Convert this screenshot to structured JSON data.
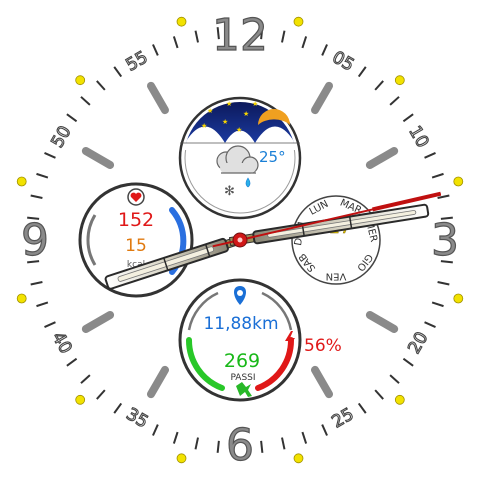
{
  "dial": {
    "hour_numerals": [
      {
        "label": "12",
        "angle": 0
      },
      {
        "label": "3",
        "angle": 90
      },
      {
        "label": "6",
        "angle": 180
      },
      {
        "label": "9",
        "angle": 270
      }
    ],
    "minute_numerals": [
      {
        "label": "05",
        "angle": 30
      },
      {
        "label": "10",
        "angle": 60
      },
      {
        "label": "20",
        "angle": 120
      },
      {
        "label": "25",
        "angle": 150
      },
      {
        "label": "35",
        "angle": 210
      },
      {
        "label": "40",
        "angle": 240
      },
      {
        "label": "50",
        "angle": 300
      },
      {
        "label": "55",
        "angle": 330
      }
    ],
    "colors": {
      "marker_gray": "#8a8a8a",
      "dot_yellow": "#f2e200",
      "tick_dark": "#333333"
    }
  },
  "weather": {
    "temperature": "25°",
    "colors": {
      "sky": "#10206e",
      "temp": "#1a7fd6"
    }
  },
  "heart": {
    "rate": "152",
    "secondary_value": "15",
    "unit": "kcal",
    "colors": {
      "rate": "#e01818",
      "secondary": "#e07a10",
      "arc": "#2a6fe0"
    }
  },
  "activity": {
    "distance": "11,88km",
    "steps": "269",
    "steps_label": "PASSI",
    "battery": "56%",
    "colors": {
      "distance": "#1a6fd6",
      "steps": "#18b818",
      "battery": "#e01818"
    }
  },
  "calendar": {
    "day_names": [
      "DOM",
      "LUN",
      "MAR",
      "MER",
      "GIO",
      "VEN",
      "SAB"
    ],
    "date": "27",
    "colors": {
      "date": "#e0c800"
    }
  },
  "hands": {
    "hour_angle": 252,
    "minute_angle": 81,
    "second_angle": 77
  }
}
